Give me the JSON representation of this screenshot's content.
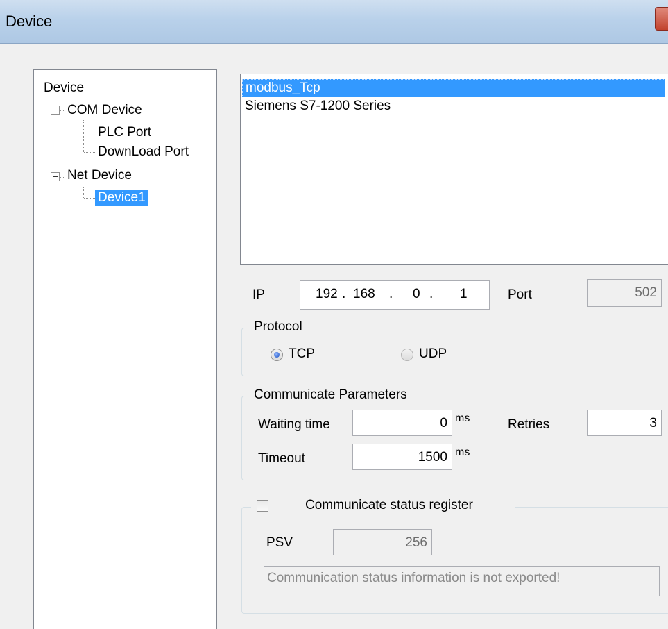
{
  "window": {
    "title": "Device"
  },
  "tree": {
    "root": "Device",
    "com_device": "COM Device",
    "plc_port": "PLC Port",
    "download_port": "DownLoad Port",
    "net_device": "Net Device",
    "device1": "Device1"
  },
  "device_list": [
    "modbus_Tcp",
    "Siemens S7-1200 Series"
  ],
  "ip": {
    "label": "IP",
    "oct1": "192",
    "oct2": "168",
    "oct3": "0",
    "oct4": "1",
    "dot": "."
  },
  "port": {
    "label": "Port",
    "value": "502"
  },
  "protocol": {
    "title": "Protocol",
    "tcp": "TCP",
    "udp": "UDP",
    "selected": "TCP"
  },
  "comm": {
    "title": "Communicate Parameters",
    "waiting_label": "Waiting time",
    "waiting_value": "0",
    "retries_label": "Retries",
    "retries_value": "3",
    "timeout_label": "Timeout",
    "timeout_value": "1500",
    "unit": "ms"
  },
  "status": {
    "title": "Communicate status register",
    "psv_label": "PSV",
    "psv_value": "256",
    "info": "Communication status information is not exported!"
  },
  "colors": {
    "selection": "#3399ff",
    "titlebar": "#b9d1ea",
    "window_bg": "#f0f0f0"
  }
}
